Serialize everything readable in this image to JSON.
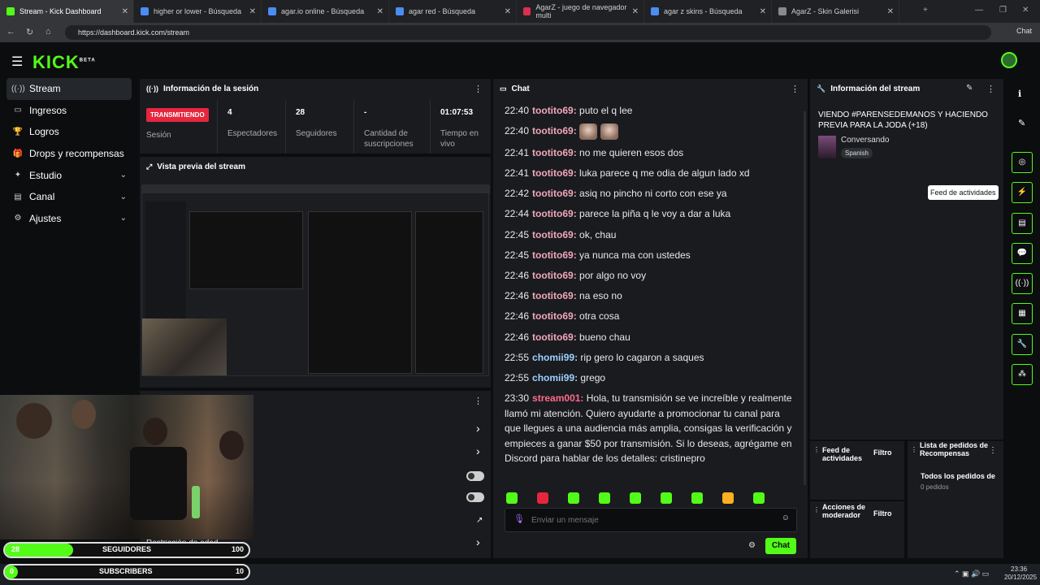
{
  "browser": {
    "tabs": [
      {
        "label": "Stream - Kick Dashboard",
        "active": true,
        "favicon_color": "#53fc18"
      },
      {
        "label": "higher or lower - Búsqueda",
        "active": false,
        "favicon_color": "#4b8cf5"
      },
      {
        "label": "agar.io online - Búsqueda",
        "active": false,
        "favicon_color": "#4b8cf5"
      },
      {
        "label": "agar red - Búsqueda",
        "active": false,
        "favicon_color": "#4b8cf5"
      },
      {
        "label": "AgarZ - juego de navegador multi",
        "active": false,
        "favicon_color": "#d9304f"
      },
      {
        "label": "agar z skins - Búsqueda",
        "active": false,
        "favicon_color": "#4b8cf5"
      },
      {
        "label": "AgarZ - Skin Galerisi",
        "active": false,
        "favicon_color": "#8a8a8a"
      }
    ],
    "url": "https://dashboard.kick.com/stream",
    "chat_button": "Chat"
  },
  "header": {
    "logo": "KICK",
    "logo_badge": "BETA"
  },
  "sidebar": {
    "items": [
      {
        "label": "Stream",
        "icon": "stream-icon",
        "glyph": "((·))",
        "active": true,
        "expandable": false
      },
      {
        "label": "Ingresos",
        "icon": "revenue-icon",
        "glyph": "▭",
        "active": false,
        "expandable": false
      },
      {
        "label": "Logros",
        "icon": "trophy-icon",
        "glyph": "🏆",
        "active": false,
        "expandable": false
      },
      {
        "label": "Drops y recompensas",
        "icon": "gift-icon",
        "glyph": "🎁",
        "active": false,
        "expandable": false
      },
      {
        "label": "Estudio",
        "icon": "studio-icon",
        "glyph": "✦",
        "active": false,
        "expandable": true
      },
      {
        "label": "Canal",
        "icon": "channel-icon",
        "glyph": "▤",
        "active": false,
        "expandable": true
      },
      {
        "label": "Ajustes",
        "icon": "settings-icon",
        "glyph": "⚙",
        "active": false,
        "expandable": true
      }
    ]
  },
  "session": {
    "title": "Información de la sesión",
    "status_badge": "TRANSMITIENDO",
    "status_label": "Sesión",
    "viewers_value": "4",
    "viewers_label": "Espectadores",
    "followers_value": "28",
    "followers_label": "Seguidores",
    "subs_value": "-",
    "subs_label": "Cantidad de suscripciones",
    "uptime_value": "01:07:53",
    "uptime_label": "Tiempo en vivo"
  },
  "preview": {
    "title": "Vista previa del stream"
  },
  "lower_panel": {
    "age_restriction_label": "Restricción de edad"
  },
  "chat": {
    "title": "Chat",
    "messages": [
      {
        "time": "22:40",
        "user": "tootito69",
        "text": "puto el q lee",
        "color": "#f1a7b8"
      },
      {
        "time": "22:40",
        "user": "tootito69",
        "text": "",
        "color": "#f1a7b8",
        "emotes": 2
      },
      {
        "time": "22:41",
        "user": "tootito69",
        "text": "no me quieren esos dos",
        "color": "#f1a7b8"
      },
      {
        "time": "22:41",
        "user": "tootito69",
        "text": "luka parece q me odia de algun lado xd",
        "color": "#f1a7b8"
      },
      {
        "time": "22:42",
        "user": "tootito69",
        "text": "asiq no pincho ni corto con ese ya",
        "color": "#f1a7b8"
      },
      {
        "time": "22:44",
        "user": "tootito69",
        "text": "parece la piña q le voy a dar a luka",
        "color": "#f1a7b8"
      },
      {
        "time": "22:45",
        "user": "tootito69",
        "text": "ok, chau",
        "color": "#f1a7b8"
      },
      {
        "time": "22:45",
        "user": "tootito69",
        "text": "ya nunca ma con ustedes",
        "color": "#f1a7b8"
      },
      {
        "time": "22:46",
        "user": "tootito69",
        "text": "por algo no voy",
        "color": "#f1a7b8"
      },
      {
        "time": "22:46",
        "user": "tootito69",
        "text": "na eso no",
        "color": "#f1a7b8"
      },
      {
        "time": "22:46",
        "user": "tootito69",
        "text": "otra cosa",
        "color": "#f1a7b8"
      },
      {
        "time": "22:46",
        "user": "tootito69",
        "text": "bueno chau",
        "color": "#f1a7b8"
      },
      {
        "time": "22:55",
        "user": "chomii99",
        "text": "rip gero lo cagaron a saques",
        "color": "#9fd0ff"
      },
      {
        "time": "22:55",
        "user": "chomii99",
        "text": "grego",
        "color": "#9fd0ff"
      },
      {
        "time": "23:30",
        "user": "stream001",
        "text": "Hola, tu transmisión se ve increíble y realmente llamó mi atención. Quiero ayudarte a promocionar tu canal para que llegues a una audiencia más amplia, consigas la verificación y empieces a ganar $50 por transmisión. Si lo deseas, agrégame en Discord para hablar de los detalles: cristinepro",
        "color": "#ff6b8a"
      }
    ],
    "input_placeholder": "Enviar un mensaje",
    "send_label": "Chat",
    "emote_colors": [
      "#53fc18",
      "#e5263e",
      "#53fc18",
      "#53fc18",
      "#53fc18",
      "#53fc18",
      "#53fc18",
      "#ffb020",
      "#53fc18",
      "#53fc18"
    ]
  },
  "stream_info": {
    "title": "Información del stream",
    "stream_title": "VIENDO #PARENSEDEMANOS Y HACIENDO PREVIA PARA LA JODA (+18)",
    "category": "Conversando",
    "language": "Spanish"
  },
  "activity": {
    "tooltip": "Feed de actividades",
    "feed_title": "Feed de actividades",
    "filter_label": "Filtro",
    "mod_title": "Acciones de moderador",
    "mod_filter_label": "Filtro"
  },
  "rewards": {
    "title": "Lista de pedidos de Recompensas",
    "all_orders": "Todos los pedidos de",
    "count": "0 pedidos"
  },
  "overlay": {
    "followers_label": "SEGUIDORES",
    "followers_value": "28",
    "followers_goal": "100",
    "subscribers_label": "SUBSCRIBERS",
    "subscribers_value": "0",
    "subscribers_goal": "10"
  },
  "taskbar": {
    "time": "23:36",
    "date": "20/12/2025"
  }
}
